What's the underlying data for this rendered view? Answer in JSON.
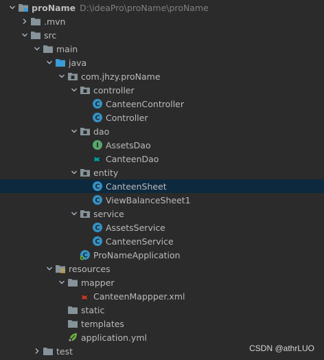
{
  "colors": {
    "background": "#2b2b2b",
    "selection": "#0d293e",
    "text": "#bbbbbb",
    "path_text": "#808080",
    "class_icon": "#3592c4",
    "interface_icon": "#59a869",
    "folder": "#87939a",
    "source_folder": "#3b9bd6"
  },
  "tree": {
    "rows": [
      {
        "label": "proName",
        "path": "D:\\ideaPro\\proName\\proName",
        "depth": 0,
        "arrow": "down",
        "icon": "module-folder-icon",
        "name": "project-root",
        "bold": true
      },
      {
        "label": ".mvn",
        "depth": 1,
        "arrow": "right",
        "icon": "folder-icon",
        "name": "folder-mvn"
      },
      {
        "label": "src",
        "depth": 1,
        "arrow": "down",
        "icon": "folder-icon",
        "name": "folder-src"
      },
      {
        "label": "main",
        "depth": 2,
        "arrow": "down",
        "icon": "folder-icon",
        "name": "folder-main"
      },
      {
        "label": "java",
        "depth": 3,
        "arrow": "down",
        "icon": "source-folder-icon",
        "name": "folder-java"
      },
      {
        "label": "com.jhzy.proName",
        "depth": 4,
        "arrow": "down",
        "icon": "package-icon",
        "name": "package-root"
      },
      {
        "label": "controller",
        "depth": 5,
        "arrow": "down",
        "icon": "package-icon",
        "name": "package-controller"
      },
      {
        "label": "CanteenController",
        "depth": 6,
        "arrow": "none",
        "icon": "class-icon",
        "name": "class-canteen-controller"
      },
      {
        "label": "Controller",
        "depth": 6,
        "arrow": "none",
        "icon": "class-icon",
        "name": "class-controller"
      },
      {
        "label": "dao",
        "depth": 5,
        "arrow": "down",
        "icon": "package-icon",
        "name": "package-dao"
      },
      {
        "label": "AssetsDao",
        "depth": 6,
        "arrow": "none",
        "icon": "interface-icon",
        "name": "interface-assets-dao"
      },
      {
        "label": "CanteenDao",
        "depth": 6,
        "arrow": "none",
        "icon": "mybatis-mapper-icon",
        "name": "interface-canteen-dao"
      },
      {
        "label": "entity",
        "depth": 5,
        "arrow": "down",
        "icon": "package-icon",
        "name": "package-entity"
      },
      {
        "label": "CanteenSheet",
        "depth": 6,
        "arrow": "none",
        "icon": "class-icon",
        "name": "class-canteen-sheet",
        "selected": true
      },
      {
        "label": "ViewBalanceSheet1",
        "depth": 6,
        "arrow": "none",
        "icon": "class-icon",
        "name": "class-view-balance-sheet1"
      },
      {
        "label": "service",
        "depth": 5,
        "arrow": "down",
        "icon": "package-icon",
        "name": "package-service"
      },
      {
        "label": "AssetsService",
        "depth": 6,
        "arrow": "none",
        "icon": "class-icon",
        "name": "class-assets-service"
      },
      {
        "label": "CanteenService",
        "depth": 6,
        "arrow": "none",
        "icon": "class-icon",
        "name": "class-canteen-service"
      },
      {
        "label": "ProNameApplication",
        "depth": 5,
        "arrow": "none",
        "icon": "spring-boot-class-icon",
        "name": "class-proname-application"
      },
      {
        "label": "resources",
        "depth": 3,
        "arrow": "down",
        "icon": "resources-folder-icon",
        "name": "folder-resources"
      },
      {
        "label": "mapper",
        "depth": 4,
        "arrow": "down",
        "icon": "folder-icon",
        "name": "folder-mapper"
      },
      {
        "label": "CanteenMappper.xml",
        "depth": 5,
        "arrow": "none",
        "icon": "mybatis-xml-icon",
        "name": "file-canteen-mappper-xml"
      },
      {
        "label": "static",
        "depth": 4,
        "arrow": "none",
        "icon": "folder-icon",
        "name": "folder-static"
      },
      {
        "label": "templates",
        "depth": 4,
        "arrow": "none",
        "icon": "folder-icon",
        "name": "folder-templates"
      },
      {
        "label": "application.yml",
        "depth": 4,
        "arrow": "none",
        "icon": "yaml-config-icon",
        "name": "file-application-yml"
      },
      {
        "label": "test",
        "depth": 2,
        "arrow": "right",
        "icon": "folder-icon",
        "name": "folder-test"
      }
    ]
  },
  "watermark": "CSDN @athrLUO"
}
